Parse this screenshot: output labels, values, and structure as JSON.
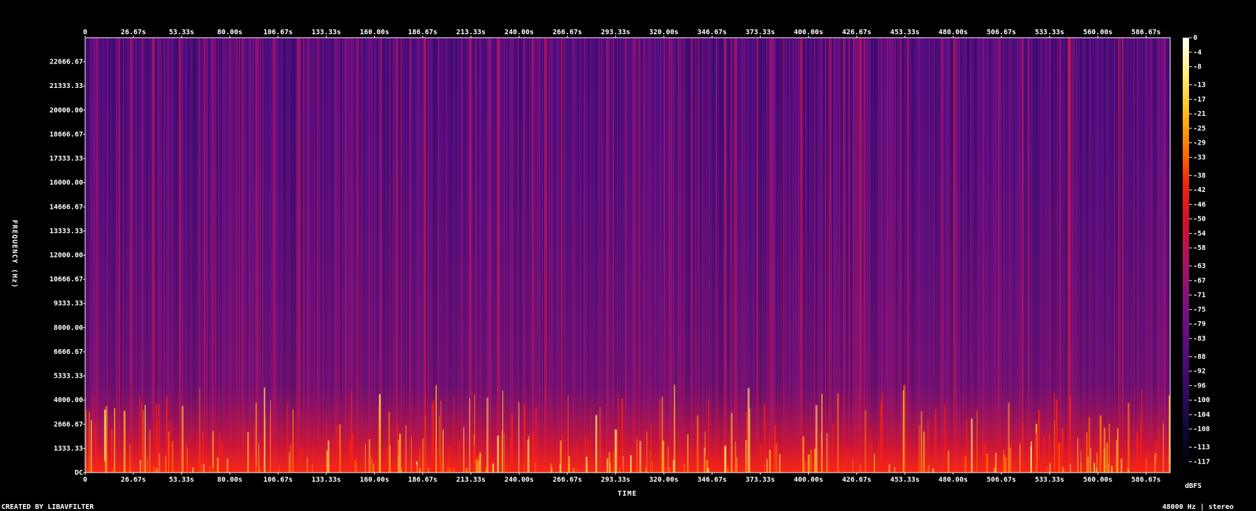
{
  "chart_data": {
    "type": "heatmap",
    "title": "",
    "xlabel": "TIME",
    "ylabel": "FREQUENCY (Hz)",
    "x_ticks": [
      "0",
      "26.67s",
      "53.33s",
      "80.00s",
      "106.67s",
      "133.33s",
      "160.00s",
      "186.67s",
      "213.33s",
      "240.00s",
      "266.67s",
      "293.33s",
      "320.00s",
      "346.67s",
      "373.33s",
      "400.00s",
      "426.67s",
      "453.33s",
      "480.00s",
      "506.67s",
      "533.33s",
      "560.00s",
      "586.67s"
    ],
    "y_ticks": [
      "DC",
      "1333.33",
      "2666.67",
      "4000.00",
      "5333.33",
      "6666.67",
      "8000.00",
      "9333.33",
      "10666.67",
      "12000.00",
      "13333.33",
      "14666.67",
      "16000.00",
      "17333.33",
      "18666.67",
      "20000.00",
      "21333.33",
      "22666.67"
    ],
    "xlim": [
      0,
      600
    ],
    "ylim": [
      0,
      24000
    ],
    "colorbar": {
      "unit": "dBFS",
      "ticks": [
        "0",
        "-4",
        "-8",
        "-13",
        "-17",
        "-21",
        "-25",
        "-29",
        "-33",
        "-38",
        "-42",
        "-46",
        "-50",
        "-54",
        "-58",
        "-63",
        "-67",
        "-71",
        "-75",
        "-79",
        "-83",
        "-88",
        "-92",
        "-96",
        "-100",
        "-104",
        "-108",
        "-113",
        "-117"
      ],
      "range": [
        -120,
        0
      ]
    },
    "colormap": [
      "#000000",
      "#0c0628",
      "#2a0a5a",
      "#4a0c78",
      "#6a0f84",
      "#8a1178",
      "#b01258",
      "#d8102a",
      "#f0280a",
      "#ff7a00",
      "#ffc21a",
      "#fff27a",
      "#ffffff"
    ]
  },
  "footer": {
    "credit": "CREATED BY LIBAVFILTER",
    "info": "48000 Hz | stereo"
  }
}
